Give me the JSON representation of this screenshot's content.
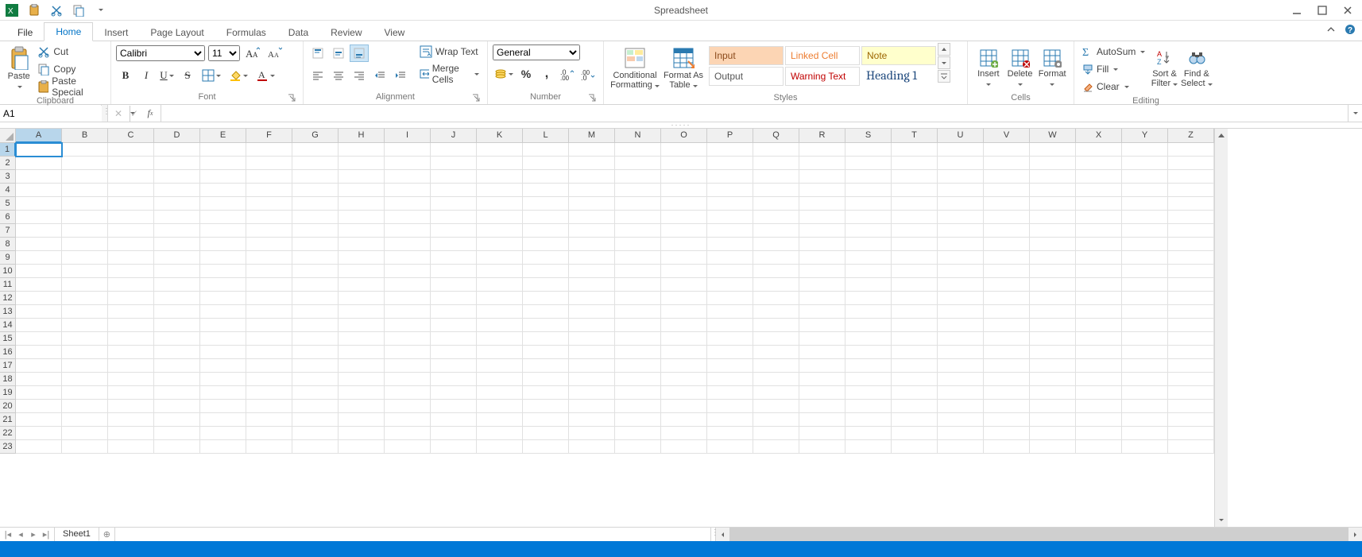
{
  "window": {
    "title": "Spreadsheet"
  },
  "tabs": {
    "file": "File",
    "home": "Home",
    "insert": "Insert",
    "pageLayout": "Page Layout",
    "formulas": "Formulas",
    "data": "Data",
    "review": "Review",
    "view": "View"
  },
  "clipboard": {
    "paste": "Paste",
    "cut": "Cut",
    "copy": "Copy",
    "pasteSpecial": "Paste Special",
    "label": "Clipboard"
  },
  "font": {
    "name": "Calibri",
    "size": "11",
    "label": "Font"
  },
  "alignment": {
    "wrapText": "Wrap Text",
    "mergeCells": "Merge Cells",
    "label": "Alignment"
  },
  "number": {
    "format": "General",
    "label": "Number"
  },
  "styles": {
    "condFmt": "Conditional Formatting",
    "fmtTable": "Format As Table",
    "input": "Input",
    "linked": "Linked Cell",
    "note": "Note",
    "output": "Output",
    "warn": "Warning Text",
    "heading": "Heading 1",
    "label": "Styles"
  },
  "cells": {
    "insert": "Insert",
    "delete": "Delete",
    "format": "Format",
    "label": "Cells"
  },
  "editing": {
    "autosum": "AutoSum",
    "fill": "Fill",
    "clear": "Clear",
    "sortFilter": "Sort & Filter",
    "findSelect": "Find & Select",
    "label": "Editing"
  },
  "nameBox": {
    "value": "A1"
  },
  "formulaBar": {
    "value": ""
  },
  "columns": [
    "A",
    "B",
    "C",
    "D",
    "E",
    "F",
    "G",
    "H",
    "I",
    "J",
    "K",
    "L",
    "M",
    "N",
    "O",
    "P",
    "Q",
    "R",
    "S",
    "T",
    "U",
    "V",
    "W",
    "X",
    "Y",
    "Z"
  ],
  "rowCount": 23,
  "selectedCol": 0,
  "selectedRow": 0,
  "sheetTabs": {
    "sheet1": "Sheet1"
  }
}
